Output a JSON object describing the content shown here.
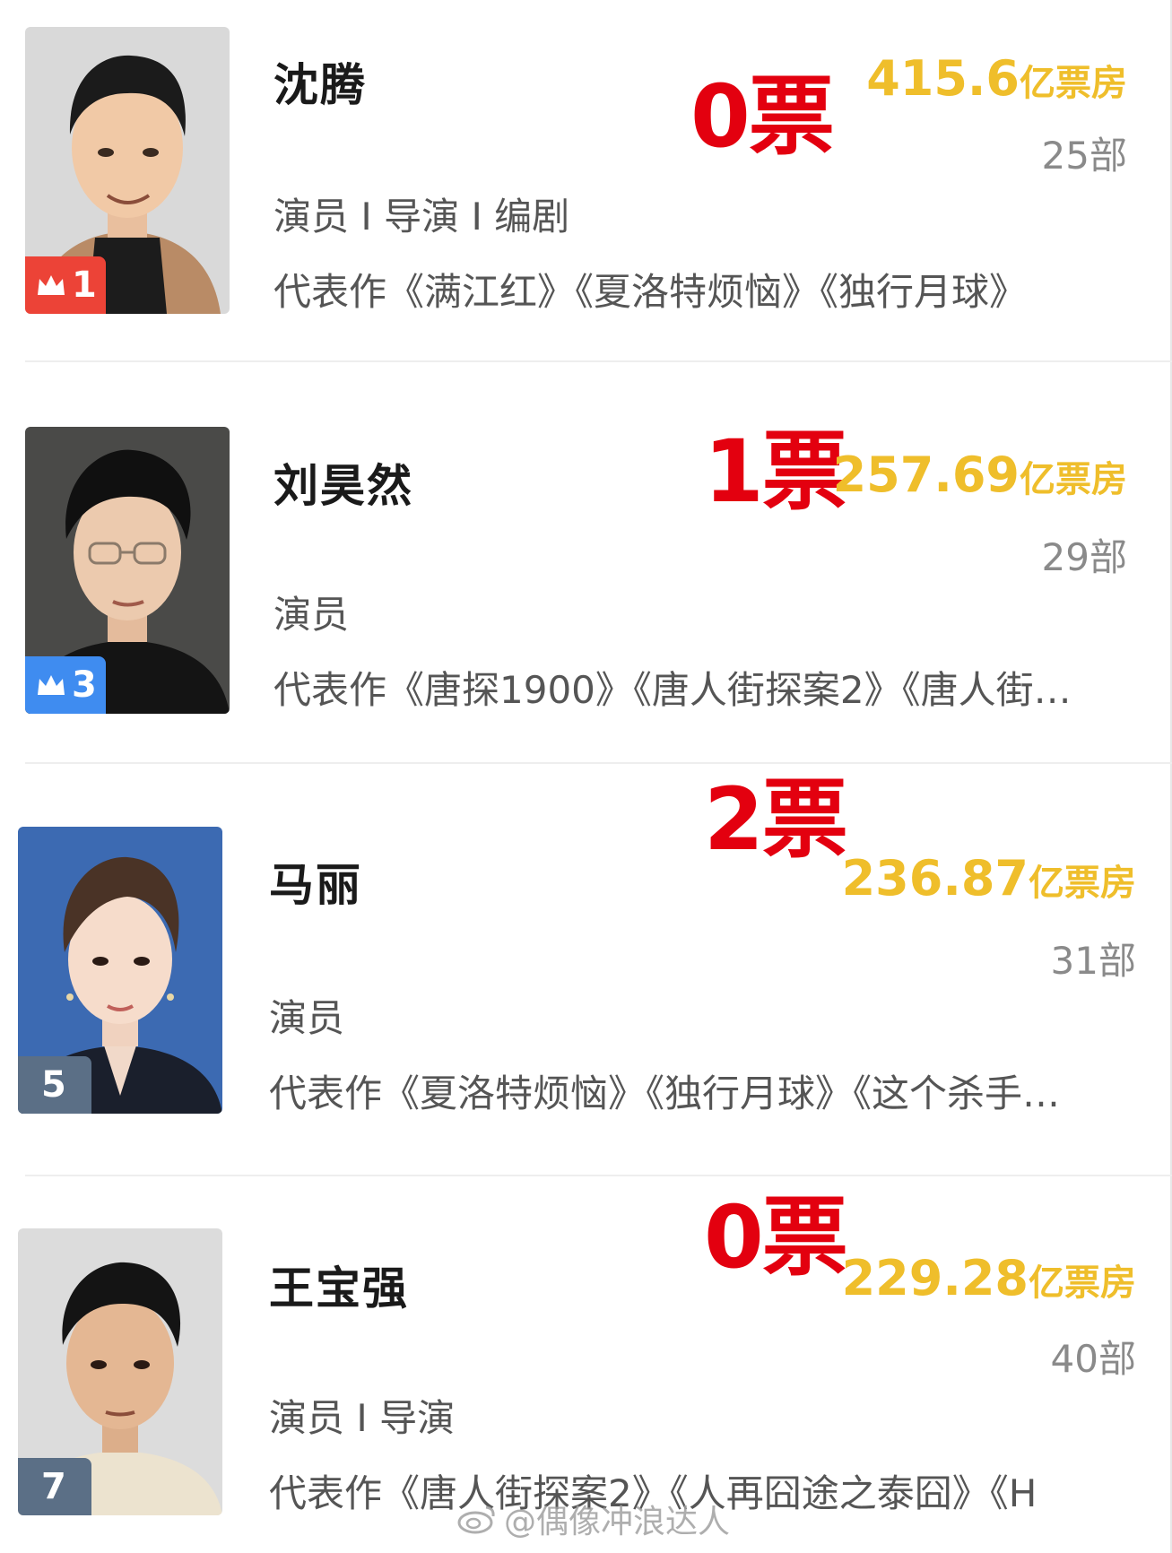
{
  "ranking": [
    {
      "name": "沈腾",
      "votes": "0票",
      "box_office_value": "415.6",
      "box_office_unit": "亿票房",
      "film_count": "25部",
      "roles": "演员 I 导演 I 编剧",
      "works": "代表作《满江红》《夏洛特烦恼》《独行月球》",
      "rank": "1",
      "badge_color": "#ec4337"
    },
    {
      "name": "刘昊然",
      "votes": "1票",
      "box_office_value": "257.69",
      "box_office_unit": "亿票房",
      "film_count": "29部",
      "roles": "演员",
      "works": "代表作《唐探1900》《唐人街探案2》《唐人街…",
      "rank": "3",
      "badge_color": "#3f8cf0"
    },
    {
      "name": "马丽",
      "votes": "2票",
      "box_office_value": "236.87",
      "box_office_unit": "亿票房",
      "film_count": "31部",
      "roles": "演员",
      "works": "代表作《夏洛特烦恼》《独行月球》《这个杀手…",
      "rank": "5",
      "badge_color": "#5b6f86"
    },
    {
      "name": "王宝强",
      "votes": "0票",
      "box_office_value": "229.28",
      "box_office_unit": "亿票房",
      "film_count": "40部",
      "roles": "演员 I 导演",
      "works": "代表作《唐人街探案2》《人再囧途之泰囧》《H",
      "rank": "7",
      "badge_color": "#5b6f86"
    }
  ],
  "watermark": "@偶像冲浪达人",
  "colors": {
    "votes": "#e3000f",
    "box_office": "#efbe2b"
  },
  "icons": {
    "crown": "crown-icon",
    "watermark": "weibo-logo-icon"
  }
}
